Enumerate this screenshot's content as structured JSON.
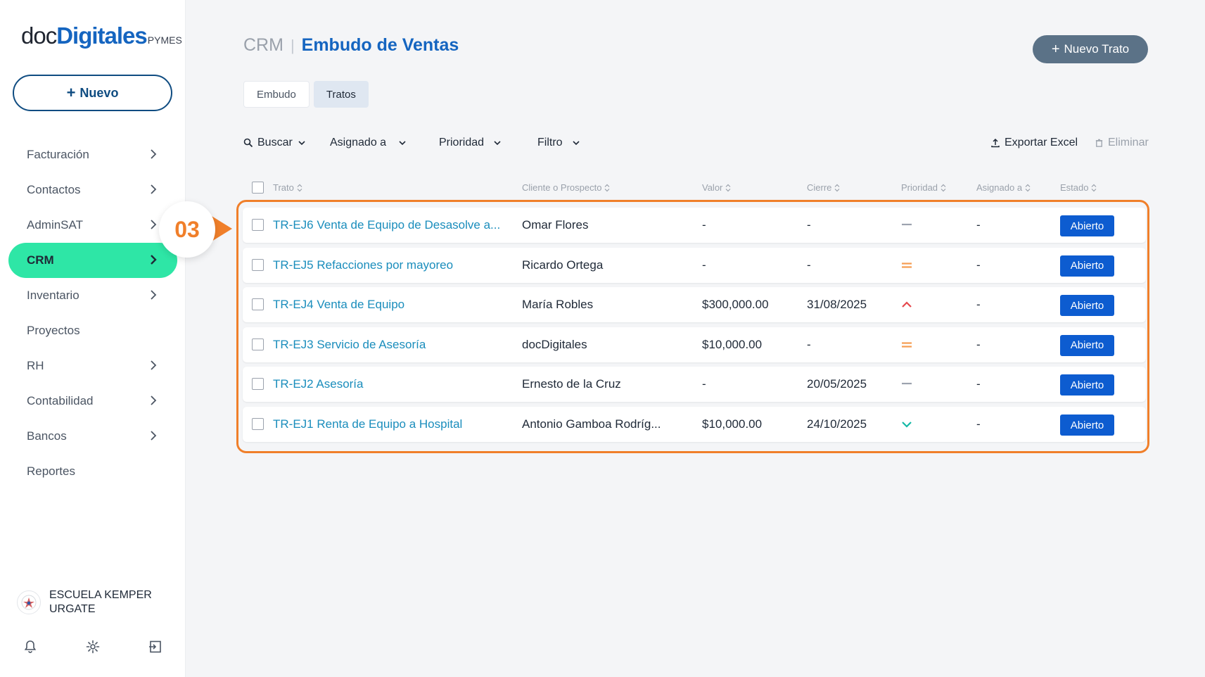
{
  "app": {
    "logo_doc": "doc",
    "logo_digitales": "Digitales",
    "logo_pymes": "PYMES"
  },
  "sidebar": {
    "new_label": "Nuevo",
    "items": [
      {
        "label": "Facturación",
        "chevron": true
      },
      {
        "label": "Contactos",
        "chevron": true
      },
      {
        "label": "AdminSAT",
        "chevron": true
      },
      {
        "label": "CRM",
        "chevron": true,
        "active": true
      },
      {
        "label": "Inventario",
        "chevron": true
      },
      {
        "label": "Proyectos",
        "chevron": false
      },
      {
        "label": "RH",
        "chevron": true
      },
      {
        "label": "Contabilidad",
        "chevron": true
      },
      {
        "label": "Bancos",
        "chevron": true
      },
      {
        "label": "Reportes",
        "chevron": false
      }
    ],
    "account_name": "ESCUELA KEMPER URGATE",
    "bottom_icons": [
      "bell-icon",
      "gear-icon",
      "logout-icon"
    ]
  },
  "header": {
    "module": "CRM",
    "separator": "|",
    "page_title": "Embudo de Ventas",
    "new_deal_label": "Nuevo Trato"
  },
  "tabs": [
    {
      "label": "Embudo",
      "active": false
    },
    {
      "label": "Tratos",
      "active": true
    }
  ],
  "filters": {
    "search": "Buscar",
    "assigned": "Asignado a",
    "priority": "Prioridad",
    "filter": "Filtro",
    "export": "Exportar Excel",
    "delete": "Eliminar"
  },
  "table": {
    "columns": [
      "Trato",
      "Cliente o Prospecto",
      "Valor",
      "Cierre",
      "Prioridad",
      "Asignado a",
      "Estado"
    ],
    "rows": [
      {
        "deal": "TR-EJ6 Venta de Equipo de Desasolve a...",
        "client": "Omar Flores",
        "value": "-",
        "close": "-",
        "priority": "low",
        "assigned": "-",
        "status": "Abierto"
      },
      {
        "deal": "TR-EJ5 Refacciones por mayoreo",
        "client": "Ricardo Ortega",
        "value": "-",
        "close": "-",
        "priority": "medium",
        "assigned": "-",
        "status": "Abierto"
      },
      {
        "deal": "TR-EJ4 Venta de Equipo",
        "client": "María Robles",
        "value": "$300,000.00",
        "close": "31/08/2025",
        "priority": "high",
        "assigned": "-",
        "status": "Abierto"
      },
      {
        "deal": "TR-EJ3 Servicio de Asesoría",
        "client": "docDigitales",
        "value": "$10,000.00",
        "close": "-",
        "priority": "medium",
        "assigned": "-",
        "status": "Abierto"
      },
      {
        "deal": "TR-EJ2 Asesoría",
        "client": "Ernesto de la Cruz",
        "value": "-",
        "close": "20/05/2025",
        "priority": "low",
        "assigned": "-",
        "status": "Abierto"
      },
      {
        "deal": "TR-EJ1 Renta de Equipo a Hospital",
        "client": "Antonio Gamboa Rodríg...",
        "value": "$10,000.00",
        "close": "24/10/2025",
        "priority": "lowest",
        "assigned": "-",
        "status": "Abierto"
      }
    ]
  },
  "callout": {
    "step": "03"
  },
  "colors": {
    "accent_blue": "#1565c0",
    "link": "#1a8dbc",
    "active_nav": "#2ee6a6",
    "status_button": "#0d5cd0",
    "callout_orange": "#f07f2a",
    "priority_high": "#e5484d",
    "priority_medium": "#f59e54",
    "priority_low": "#9ca3af",
    "priority_lowest": "#14b8a6"
  }
}
